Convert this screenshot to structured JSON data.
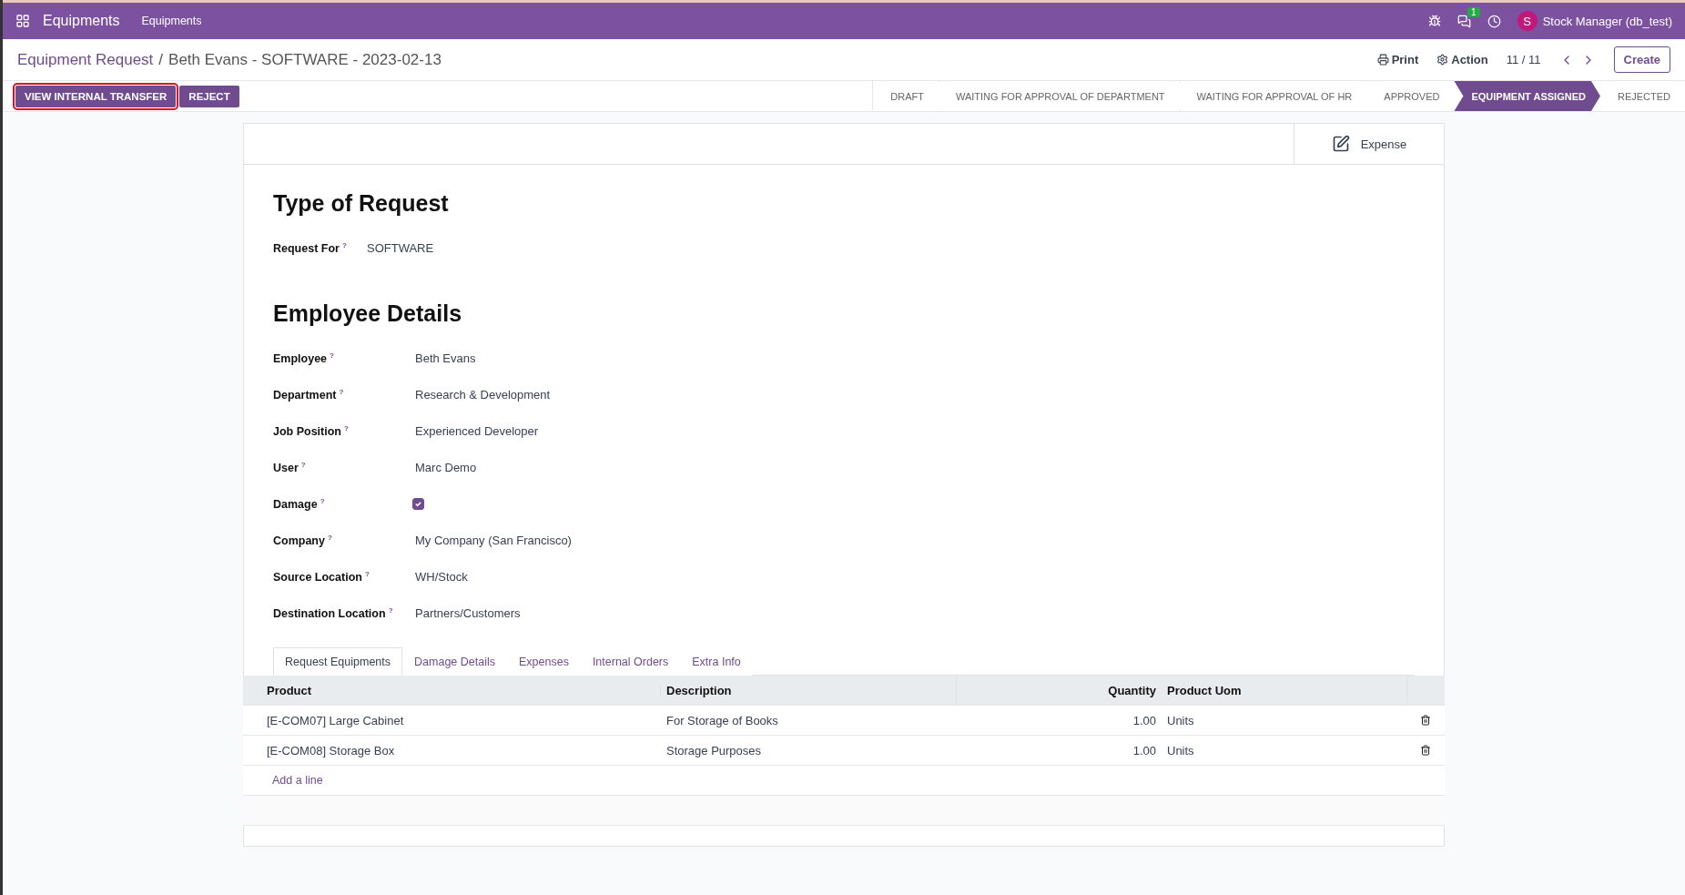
{
  "navbar": {
    "app_name": "Equipments",
    "menu": [
      "Equipments"
    ],
    "chat_badge": "1",
    "user": {
      "initial": "S",
      "name": "Stock Manager (db_test)"
    }
  },
  "breadcrumb": {
    "parent": "Equipment Request",
    "separator": "/",
    "current": "Beth Evans - SOFTWARE - 2023-02-13"
  },
  "control_panel": {
    "print": "Print",
    "action": "Action",
    "pager": "11 / 11",
    "create": "Create"
  },
  "header_buttons": [
    {
      "label": "VIEW INTERNAL TRANSFER",
      "highlighted": true
    },
    {
      "label": "REJECT",
      "highlighted": false
    }
  ],
  "statusbar": [
    {
      "label": "DRAFT",
      "selected": false
    },
    {
      "label": "WAITING FOR APPROVAL OF DEPARTMENT",
      "selected": false
    },
    {
      "label": "WAITING FOR APPROVAL OF HR",
      "selected": false
    },
    {
      "label": "APPROVED",
      "selected": false
    },
    {
      "label": "EQUIPMENT ASSIGNED",
      "selected": true
    },
    {
      "label": "REJECTED",
      "selected": false
    }
  ],
  "smart_button": {
    "label": "Expense"
  },
  "sections": [
    {
      "title": "Type of Request",
      "fields": [
        {
          "label": "Request For",
          "help": "?",
          "kind": "text",
          "value": "SOFTWARE"
        }
      ]
    },
    {
      "title": "Employee Details",
      "fields": [
        {
          "label": "Employee",
          "help": "?",
          "kind": "text",
          "value": "Beth Evans"
        },
        {
          "label": "Department",
          "help": "?",
          "kind": "text",
          "value": "Research & Development"
        },
        {
          "label": "Job Position",
          "help": "?",
          "kind": "text",
          "value": "Experienced Developer"
        },
        {
          "label": "User",
          "help": "?",
          "kind": "text",
          "value": "Marc Demo"
        },
        {
          "label": "Damage",
          "help": "?",
          "kind": "checkbox",
          "checked": true
        },
        {
          "label": "Company",
          "help": "?",
          "kind": "text",
          "value": "My Company (San Francisco)"
        },
        {
          "label": "Source Location",
          "help": "?",
          "kind": "text",
          "value": "WH/Stock"
        },
        {
          "label": "Destination Location",
          "help": "?",
          "kind": "text",
          "value": "Partners/Customers"
        }
      ]
    }
  ],
  "notebook": {
    "tabs": [
      {
        "label": "Request Equipments",
        "selected": true
      },
      {
        "label": "Damage Details",
        "selected": false
      },
      {
        "label": "Expenses",
        "selected": false
      },
      {
        "label": "Internal Orders",
        "selected": false
      },
      {
        "label": "Extra Info",
        "selected": false
      }
    ],
    "table": {
      "columns": [
        "Product",
        "Description",
        "Quantity",
        "Product Uom"
      ],
      "rows": [
        {
          "product": "[E-COM07] Large Cabinet",
          "description": "For Storage of Books",
          "quantity": "1.00",
          "uom": "Units"
        },
        {
          "product": "[E-COM08] Storage Box",
          "description": "Storage Purposes",
          "quantity": "1.00",
          "uom": "Units"
        }
      ],
      "add_line": "Add a line"
    }
  }
}
